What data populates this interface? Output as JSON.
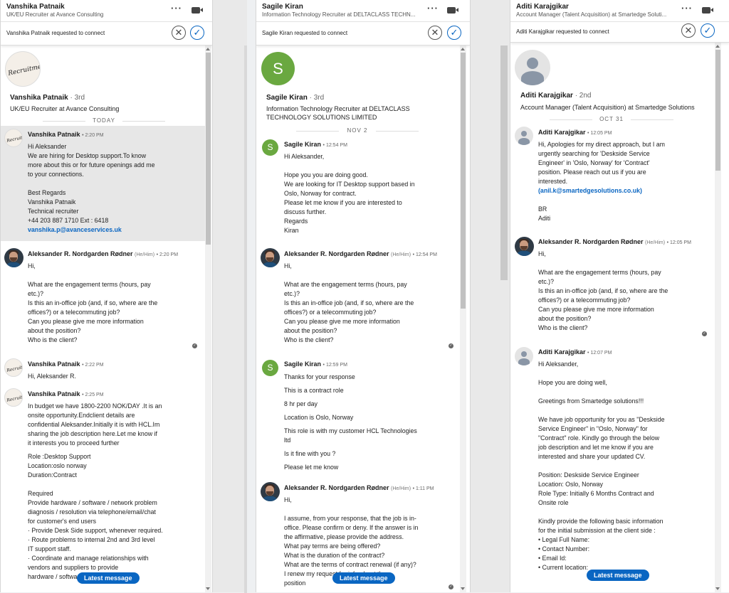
{
  "panels": [
    {
      "header": {
        "name": "Vanshika Patnaik",
        "subtitle": "UK/EU Recruiter at Avance Consulting"
      },
      "request": "Vanshika Patnaik requested to connect",
      "profile": {
        "name": "Vanshika Patnaik",
        "degree": "· 3rd",
        "title_lines": [
          "UK/EU Recruiter at Avance Consulting"
        ],
        "avatar_text": "Recruitment"
      },
      "date_separator": "TODAY",
      "messages": [
        {
          "sender": "Vanshika Patnaik",
          "pronouns": "",
          "time": "• 2:20 PM",
          "lines": [
            "Hi Aleksander",
            "We are hiring for Desktop support.To know",
            "more about this or for future openings add me",
            "to your connections.",
            "",
            "Best Regards",
            "Vanshika Patnaik",
            "Technical recruiter",
            "+44 203 887 1710 Ext : 6418"
          ],
          "link": "vanshika.p@avanceservices.uk"
        },
        {
          "sender": "Aleksander R. Nordgarden Rødner",
          "pronouns": "(He/Him)",
          "time": "• 2:20 PM",
          "lines": [
            "Hi,",
            "",
            "What are the engagement terms (hours, pay",
            "etc.)?",
            "Is this an in-office job (and, if so, where are the",
            "offices?) or a telecommuting job?",
            "Can you please give me more information",
            "about the position?",
            "Who is the client?"
          ]
        },
        {
          "sender": "Vanshika Patnaik",
          "pronouns": "",
          "time": "• 2:22 PM",
          "lines": [
            "Hi, Aleksander R."
          ]
        },
        {
          "sender": "Vanshika Patnaik",
          "pronouns": "",
          "time": "• 2:25 PM",
          "lines": [
            "In budget we have 1800-2200 NOK/DAY .It is an",
            "onsite opportunity.Endclient details are",
            "confidential Aleksander.Initially it is with HCL.Im",
            "sharing the job description here.Let me know if",
            "it interests you to proceed further",
            "",
            "Role :Desktop Support",
            "Location:oslo norway",
            "Duration:Contract",
            "",
            "Required",
            "Provide hardware / software / network problem",
            "diagnosis / resolution via telephone/email/chat",
            "for customer's end users",
            "· Provide Desk Side support, whenever required.",
            "· Route problems to internal 2nd and 3rd level",
            "IT support staff.",
            "· Coordinate and manage relationships with",
            "vendors and suppliers to provide",
            "hardware / software / network problem"
          ]
        }
      ],
      "latest_label": "Latest message"
    },
    {
      "header": {
        "name": "Sagile Kiran",
        "subtitle": "Information Technology Recruiter at DELTACLASS TECHN..."
      },
      "request": "Sagile Kiran requested to connect",
      "profile": {
        "name": "Sagile Kiran",
        "degree": "· 3rd",
        "title_lines": [
          "Information Technology Recruiter at DELTACLASS",
          "TECHNOLOGY SOLUTIONS LIMITED"
        ],
        "avatar_text": "S"
      },
      "date_separator": "NOV 2",
      "messages": [
        {
          "sender": "Sagile Kiran",
          "pronouns": "",
          "time": "• 12:54 PM",
          "lines": [
            "Hi Aleksander,",
            "",
            "Hope you you are doing good.",
            "We are looking for IT Desktop support based in",
            "Oslo, Norway for contract.",
            "Please let me know if you are interested to",
            "discuss further.",
            "Regards",
            "Kiran"
          ]
        },
        {
          "sender": "Aleksander R. Nordgarden Rødner",
          "pronouns": "(He/Him)",
          "time": "• 12:54 PM",
          "lines": [
            "Hi,",
            "",
            "What are the engagement terms (hours, pay",
            "etc.)?",
            "Is this an in-office job (and, if so, where are the",
            "offices?) or a telecommuting job?",
            "Can you please give me more information",
            "about the position?",
            "Who is the client?"
          ]
        },
        {
          "sender": "Sagile Kiran",
          "pronouns": "",
          "time": "• 12:59 PM",
          "lines": [
            "Thanks for your response",
            "This is a contract role",
            "8 hr per day",
            "Location is Oslo, Norway",
            "This role is with my customer HCL Technologies",
            "ltd",
            "Is it fine with you ?",
            "Please let me know"
          ]
        },
        {
          "sender": "Aleksander R. Nordgarden Rødner",
          "pronouns": "(He/Him)",
          "time": "• 1:11 PM",
          "lines": [
            "Hi,",
            "",
            "I assume, from your response, that the job is in-",
            "office. Please confirm or deny. If the answer is in",
            "the affirmative, please provide the address.",
            "What pay terms are being offered?",
            "What is the duration of the contract?",
            "What are the terms of contract renewal (if any)?",
            "I renew my request for info about the",
            "position"
          ]
        }
      ],
      "latest_label": "Latest message"
    },
    {
      "header": {
        "name": "Aditi Karajgikar",
        "subtitle": "Account Manager (Talent Acquisition) at Smartedge Soluti..."
      },
      "request": "Aditi Karajgikar requested to connect",
      "profile": {
        "name": "Aditi Karajgikar",
        "degree": "· 2nd",
        "title_lines": [
          "Account Manager (Talent Acquisition) at Smartedge Solutions"
        ],
        "avatar_text": ""
      },
      "date_separator": "OCT 31",
      "messages": [
        {
          "sender": "Aditi Karajgikar",
          "pronouns": "",
          "time": "• 12:05 PM",
          "lines": [
            "Hi, Apologies for my direct approach, but I am",
            "urgently searching for 'Deskside Service",
            "Engineer' in 'Oslo, Norway' for 'Contract'",
            "position. Please reach out us if you are",
            "interested.",
            "(anil.k@smartedgesolutions.co.uk)",
            "",
            "BR",
            "Aditi"
          ]
        },
        {
          "sender": "Aleksander R. Nordgarden Rødner",
          "pronouns": "(He/Him)",
          "time": "• 12:05 PM",
          "lines": [
            "Hi,",
            "",
            "What are the engagement terms (hours, pay",
            "etc.)?",
            "Is this an in-office job (and, if so, where are the",
            "offices?) or a telecommuting job?",
            "Can you please give me more information",
            "about the position?",
            "Who is the client?"
          ]
        },
        {
          "sender": "Aditi Karajgikar",
          "pronouns": "",
          "time": "• 12:07 PM",
          "lines": [
            "Hi Aleksander,",
            "",
            "Hope you are doing well,",
            "",
            "Greetings from Smartedge solutions!!!",
            "",
            "We have job opportunity for you as \"Deskside",
            "Service Engineer\" in \"Oslo, Norway\" for",
            "\"Contract\" role. Kindly go through the below",
            "job description and let me know if you are",
            "interested and share your updated CV.",
            "",
            "Position: Deskside Service Engineer",
            "Location: Oslo, Norway",
            "Role Type: Initially 6 Months Contract and",
            "Onsite role",
            "",
            "Kindly provide the following basic information",
            "for the initial submission at the client side :",
            "• Legal Full Name:",
            "• Contact Number:",
            "• Email Id:",
            "• Current location:"
          ]
        }
      ],
      "latest_label": "Latest message"
    }
  ],
  "colors": {
    "accent": "#0a66c2",
    "sagile_avatar": "#6aa840"
  },
  "icons": [
    "more-icon",
    "video-icon",
    "decline-icon",
    "accept-icon",
    "seen-check-icon"
  ]
}
